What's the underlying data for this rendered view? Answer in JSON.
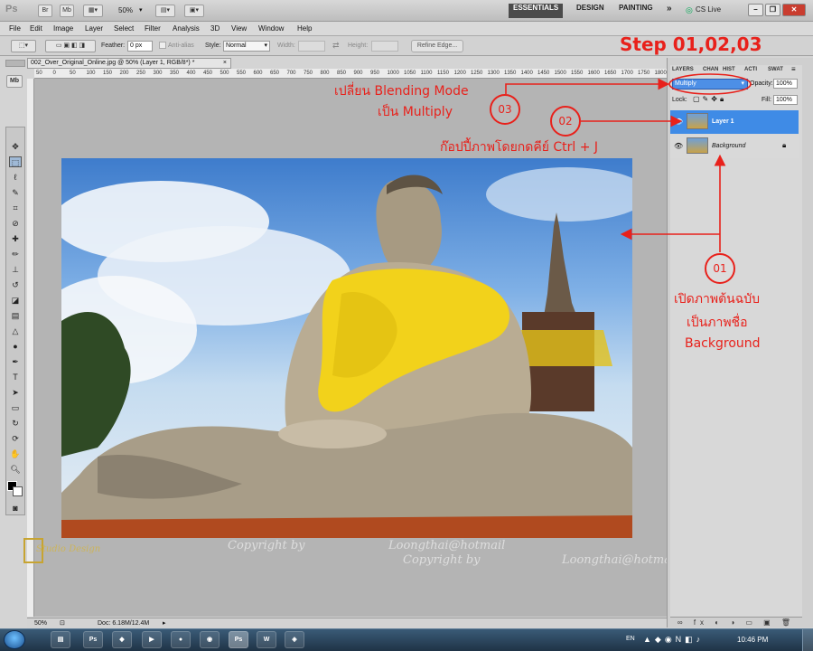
{
  "app": {
    "logo": "Ps",
    "zoom": "50%",
    "workspaces": [
      "ESSENTIALS",
      "DESIGN",
      "PAINTING"
    ],
    "more": "»",
    "cslive": "CS Live",
    "window_controls": [
      "minimize-icon",
      "restore-icon",
      "close-icon"
    ]
  },
  "menu": [
    "File",
    "Edit",
    "Image",
    "Layer",
    "Select",
    "Filter",
    "Analysis",
    "3D",
    "View",
    "Window",
    "Help"
  ],
  "options": {
    "feather_label": "Feather:",
    "feather_value": "0 px",
    "antialias": "Anti-alias",
    "style_label": "Style:",
    "style_value": "Normal",
    "width_label": "Width:",
    "height_label": "Height:",
    "refine": "Refine Edge..."
  },
  "document": {
    "tab_title": "002_Over_Original_Online.jpg @ 50% (Layer 1, RGB/8*) *",
    "tab_close": "×",
    "ruler_marks": [
      "50",
      "0",
      "50",
      "100",
      "150",
      "200",
      "250",
      "300",
      "350",
      "400",
      "450",
      "500",
      "550",
      "600",
      "650",
      "700",
      "750",
      "800",
      "850",
      "900",
      "950",
      "1000",
      "1050",
      "1100",
      "1150",
      "1200",
      "1250",
      "1300",
      "1350",
      "1400",
      "1450",
      "1500",
      "1550",
      "1600",
      "1650",
      "1700",
      "1750",
      "1800",
      "18"
    ],
    "status_zoom": "50%",
    "status_doc": "Doc: 6.18M/12.4M"
  },
  "panel": {
    "tabs": [
      "LAYERS",
      "CHAN",
      "HIST",
      "ACTI",
      "SWAT"
    ],
    "blend_mode": "Multiply",
    "opacity_label": "Opacity:",
    "opacity_value": "100%",
    "lock_label": "Lock:",
    "fill_label": "Fill:",
    "fill_value": "100%",
    "layers": [
      {
        "name": "Layer 1",
        "selected": true
      },
      {
        "name": "Background",
        "selected": false
      }
    ],
    "bottom_icons": "∞ fx ◐ ◑ ▭ ▣ 🗑"
  },
  "annotations": {
    "step": "Step 01,02,03",
    "blend_text_1": "เปลี่ยน Blending Mode",
    "blend_text_2": "เป็น Multiply",
    "circle_03": "03",
    "circle_02": "02",
    "circle_01": "01",
    "copy_text": "ก๊อปปี้ภาพโดยกดคีย์ Ctrl + J",
    "open_text_1": "เปิดภาพต้นฉบับ",
    "open_text_2": "เป็นภาพชื่อ",
    "open_text_3": "Background",
    "accent": "#e8211b"
  },
  "watermark": {
    "copyright_1": "Copyright by",
    "email_1": "Loongthai@hotmail",
    "copyright_2": "Copyright by",
    "email_2": "Loongthai@hotmail.com",
    "symbol": "©"
  },
  "taskbar": {
    "lang": "EN",
    "time": "10:46 PM"
  }
}
